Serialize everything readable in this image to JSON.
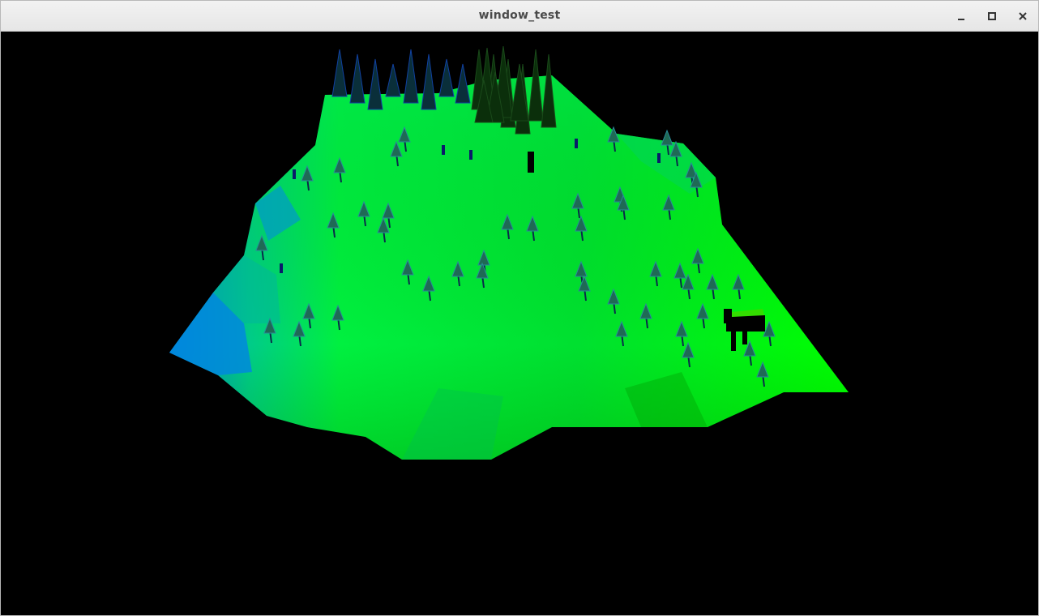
{
  "window": {
    "title": "window_test"
  },
  "controls": {
    "minimize_icon": "minimize-icon",
    "maximize_icon": "maximize-icon",
    "close_icon": "close-icon"
  },
  "scene": {
    "background": "#000000",
    "terrain_colors": [
      "#00ff00",
      "#00e632",
      "#00cc66",
      "#0099cc",
      "#00b300"
    ],
    "tree_color": "#1f5f3a",
    "tree_trunk": "#0a2a4a",
    "conifer_color": "#0b2f0b"
  }
}
